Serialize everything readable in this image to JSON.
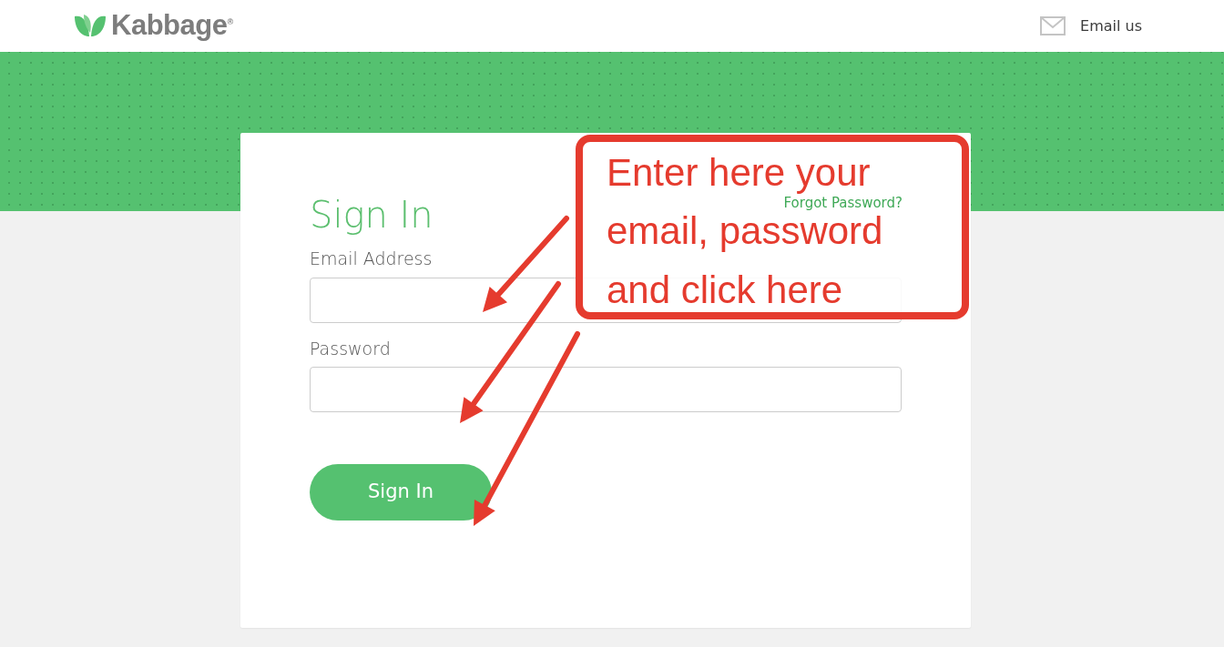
{
  "header": {
    "brand": "Kabbage",
    "brand_mark": "®",
    "contact_link": "Email us"
  },
  "sign_in": {
    "title": "Sign In",
    "forgot_link": "Forgot Password?",
    "fields": [
      {
        "label": "Email Address"
      },
      {
        "label": "Password"
      }
    ],
    "submit": "Sign In"
  },
  "annotation": {
    "lines": [
      "Enter here your",
      "email, password",
      "and click here"
    ]
  }
}
